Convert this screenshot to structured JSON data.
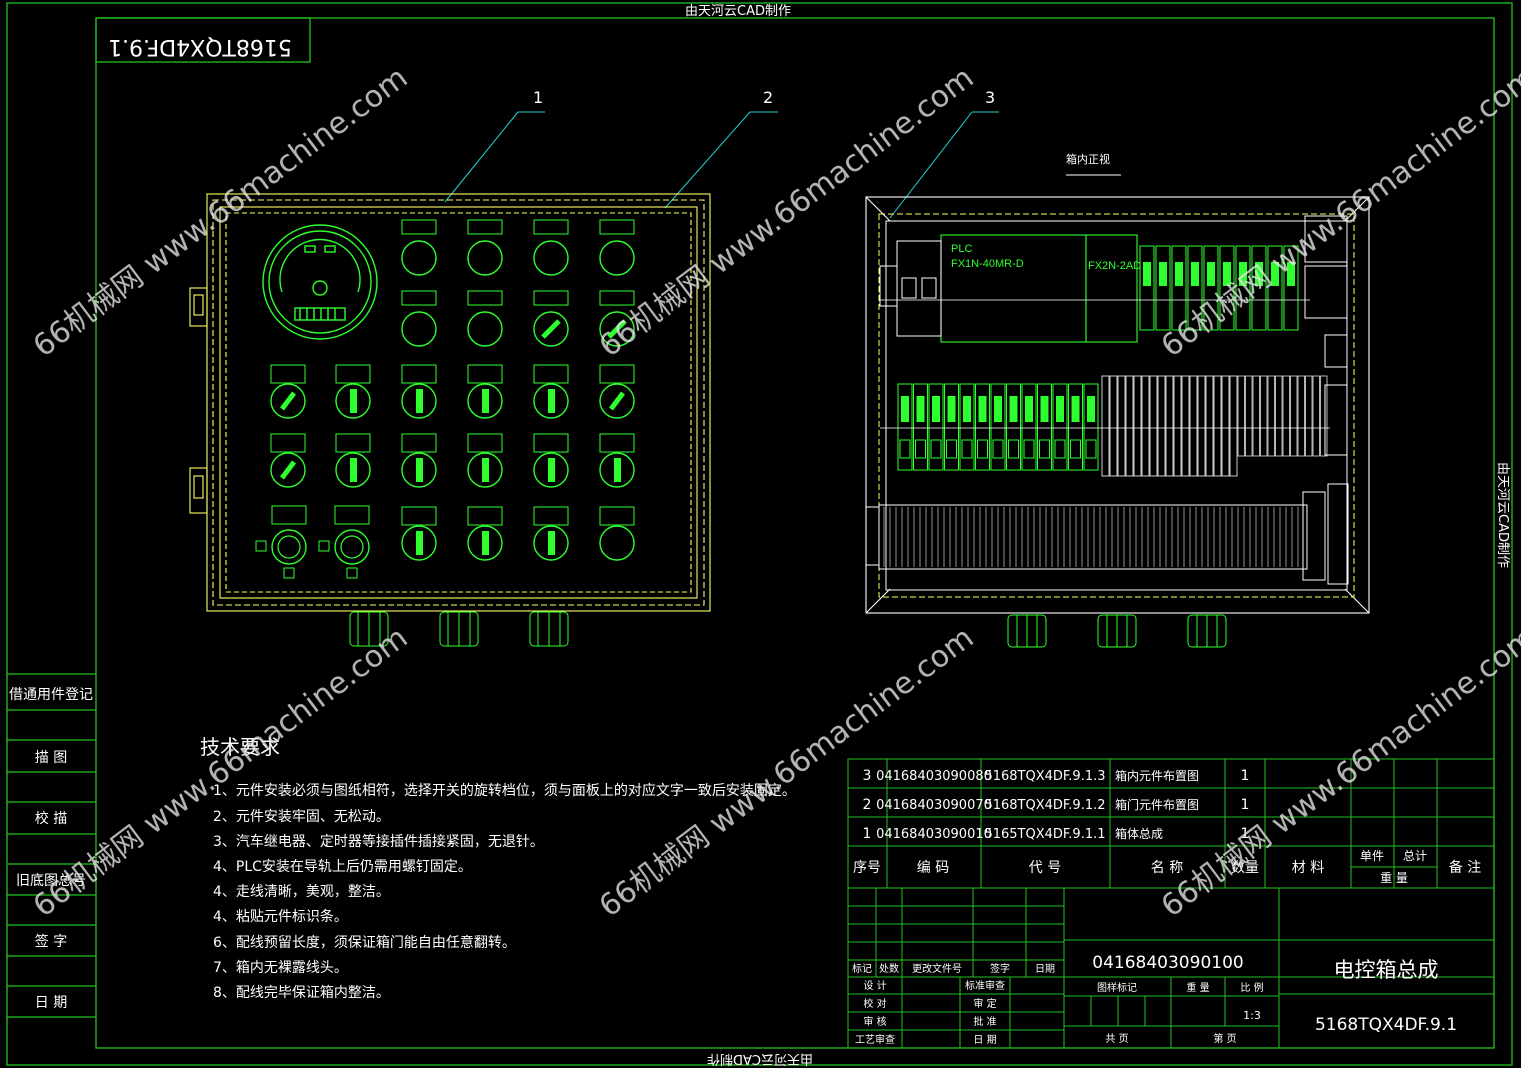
{
  "sheet": {
    "top_caption": "由天河云CAD制作",
    "bottom_caption": "由天河云CAD制作",
    "right_caption": "由天河云CAD制作",
    "mirrored_code": "5168TQX4DF.9.1"
  },
  "callouts": [
    "1",
    "2",
    "3"
  ],
  "views": {
    "right_view_title": "箱内正视",
    "plc_label_line1": "PLC",
    "plc_label_line2": "FX1N-40MR-D",
    "ad_label": "FX2N-2AD"
  },
  "side_panel": [
    "借通用件登记",
    "描 图",
    "校 描",
    "旧底图总号",
    "签 字",
    "日 期"
  ],
  "tech_requirements": {
    "title": "技术要求",
    "items": [
      "1、元件安装必须与图纸相符，选择开关的旋转档位，须与面板上的对应文字一致后安装固定。",
      "2、元件安装牢固、无松动。",
      "3、汽车继电器、定时器等接插件插接紧固，无退针。",
      "4、PLC安装在导轨上后仍需用螺钉固定。",
      "4、走线清晰，美观，整洁。",
      "4、粘贴元件标识条。",
      "6、配线预留长度，须保证箱门能自由任意翻转。",
      "7、箱内无裸露线头。",
      "8、配线完毕保证箱内整洁。"
    ]
  },
  "bom": {
    "rows": [
      {
        "seq": "3",
        "code": "04168403090080",
        "drawing": "5168TQX4DF.9.1.3",
        "name": "箱内元件布置图",
        "qty": "1"
      },
      {
        "seq": "2",
        "code": "04168403090070",
        "drawing": "5168TQX4DF.9.1.2",
        "name": "箱门元件布置图",
        "qty": "1"
      },
      {
        "seq": "1",
        "code": "04168403090010",
        "drawing": "5165TQX4DF.9.1.1",
        "name": "箱体总成",
        "qty": "1"
      }
    ],
    "headers": {
      "seq": "序号",
      "code": "编 码",
      "drawing": "代 号",
      "name": "名 称",
      "qty": "数量",
      "material": "材 料",
      "unit": "单件",
      "total": "总计",
      "weight": "重 量",
      "remark": "备 注"
    }
  },
  "title_block": {
    "part_code": "04168403090100",
    "title": "电控箱总成",
    "drawing_no": "5168TQX4DF.9.1",
    "scale": "1:3",
    "labels": {
      "mark": "标记",
      "count": "处数",
      "change_doc": "更改文件号",
      "sign": "签字",
      "date": "日期",
      "design": "设 计",
      "std_review": "标准审查",
      "check": "校 对",
      "audit": "审 定",
      "review": "审 核",
      "approve": "批 准",
      "process": "工艺审查",
      "date2": "日 期",
      "stage": "图样标记",
      "weight": "重 量",
      "ratio": "比 例",
      "total_pages": "共 页",
      "page": "第 页"
    }
  },
  "watermark": "66机械网 www.66machine.com",
  "colors": {
    "frame": "#21c21f",
    "panel": "#ffff66",
    "bright": "#2eff2e",
    "leader": "#22d3d3",
    "text": "#ffffff"
  }
}
